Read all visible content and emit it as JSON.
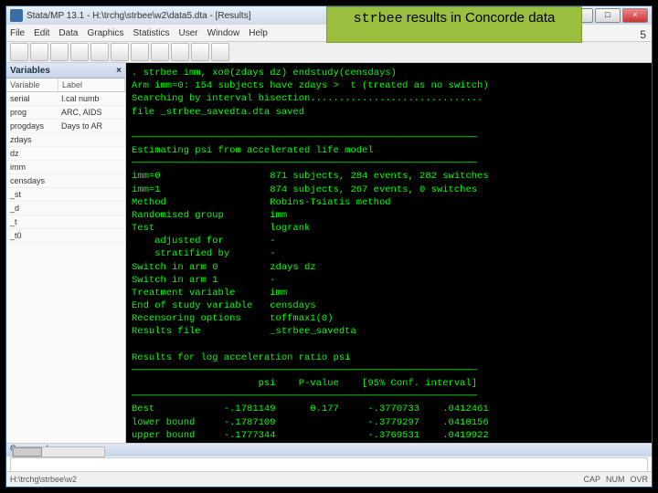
{
  "slide": {
    "title_mono": "strbee",
    "title_rest": " results in Concorde data",
    "page": "5"
  },
  "window": {
    "title": "Stata/MP 13.1 - H:\\trchg\\strbee\\w2\\data5.dta - [Results]"
  },
  "menu": {
    "file": "File",
    "edit": "Edit",
    "data": "Data",
    "graphics": "Graphics",
    "statistics": "Statistics",
    "user": "User",
    "window": "Window",
    "help": "Help"
  },
  "variables": {
    "hdr": "Variables",
    "col1": "Variable",
    "col2": "Label",
    "rows": [
      {
        "v": "serial",
        "l": "I.cal numb"
      },
      {
        "v": "prog",
        "l": "ARC, AIDS"
      },
      {
        "v": "progdays",
        "l": "Days to AR"
      },
      {
        "v": "zdays",
        "l": ""
      },
      {
        "v": "dz",
        "l": ""
      },
      {
        "v": "imm",
        "l": ""
      },
      {
        "v": "censdays",
        "l": ""
      },
      {
        "v": "_st",
        "l": ""
      },
      {
        "v": "_d",
        "l": ""
      },
      {
        "v": "_t",
        "l": ""
      },
      {
        "v": "_t0",
        "l": ""
      }
    ]
  },
  "results": {
    "cmd": ". strbee imm, xo0(zdays dz) endstudy(censdays)",
    "l1": "Arm imm=0: 154 subjects have zdays >  t (treated as no switch)",
    "l2": "Searching by interval bisection..............................",
    "l3": "file _strbee_savedta.dta saved",
    "sec1": "Estimating psi from accelerated life model",
    "rows1": [
      [
        "imm=0",
        "871 subjects, 284 events, 282 switches"
      ],
      [
        "imm=1",
        "874 subjects, 267 events, 0 switches"
      ],
      [
        "Method",
        "Robins-Tsiatis method"
      ],
      [
        "Randomised group",
        "imm"
      ],
      [
        "Test",
        "logrank"
      ],
      [
        "    adjusted for",
        "-"
      ],
      [
        "    stratified by",
        "-"
      ],
      [
        "Switch in arm 0",
        "zdays dz"
      ],
      [
        "Switch in arm 1",
        "-"
      ],
      [
        "Treatment variable",
        "imm"
      ],
      [
        "End of study variable",
        "censdays"
      ],
      [
        "Recensoring options",
        "toffmax1(0)"
      ],
      [
        "Results file",
        "_strbee_savedta"
      ]
    ],
    "sec2": "Results for log acceleration ratio psi",
    "tblhdr": [
      "",
      "psi",
      "P-value",
      "[95% Conf. interval]"
    ],
    "tbl": [
      [
        "Best",
        "-.1781149",
        "0.177",
        "-.3770733",
        ".0412461"
      ],
      [
        "lower bound",
        "-.1787109",
        "",
        "-.3779297",
        ".0410156"
      ],
      [
        "upper bound",
        "-.1777344",
        "",
        "-.3769531",
        ".0419922"
      ]
    ]
  },
  "command": {
    "hdr": "Command"
  },
  "status": {
    "path": "H:\\trchg\\strbee\\w2",
    "cap": "CAP",
    "num": "NUM",
    "ovr": "OVR"
  }
}
